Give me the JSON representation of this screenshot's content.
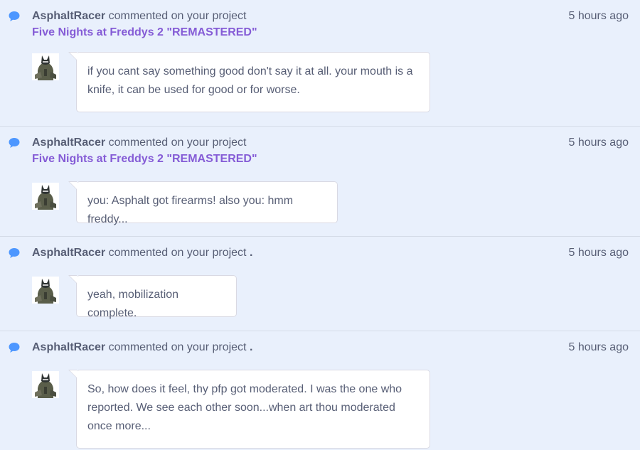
{
  "colors": {
    "background": "#e9f0fc",
    "text": "#575e75",
    "link": "#855cd6",
    "icon": "#4d97ff",
    "bubble": "#ffffff"
  },
  "items": [
    {
      "icon": "comment-icon",
      "username": "AsphaltRacer",
      "verb": "commented on your project",
      "suffix": "",
      "project": "Five Nights at Freddys 2 \"REMASTERED\"",
      "timestamp": "5 hours ago",
      "comment": "if you cant say something good don't say it at all. your mouth is a knife, it can be used for good or for worse."
    },
    {
      "icon": "comment-icon",
      "username": "AsphaltRacer",
      "verb": "commented on your project",
      "suffix": "",
      "project": "Five Nights at Freddys 2 \"REMASTERED\"",
      "timestamp": "5 hours ago",
      "comment": "you: Asphalt got firearms! also you: hmm freddy..."
    },
    {
      "icon": "comment-icon",
      "username": "AsphaltRacer",
      "verb": "commented on your project",
      "suffix": ".",
      "project": "",
      "timestamp": "5 hours ago",
      "comment": "yeah, mobilization complete."
    },
    {
      "icon": "comment-icon",
      "username": "AsphaltRacer",
      "verb": "commented on your project",
      "suffix": ".",
      "project": "",
      "timestamp": "5 hours ago",
      "comment": "So, how does it feel, thy pfp got moderated. I was the one who reported. We see each other soon...when art thou moderated once more..."
    }
  ]
}
